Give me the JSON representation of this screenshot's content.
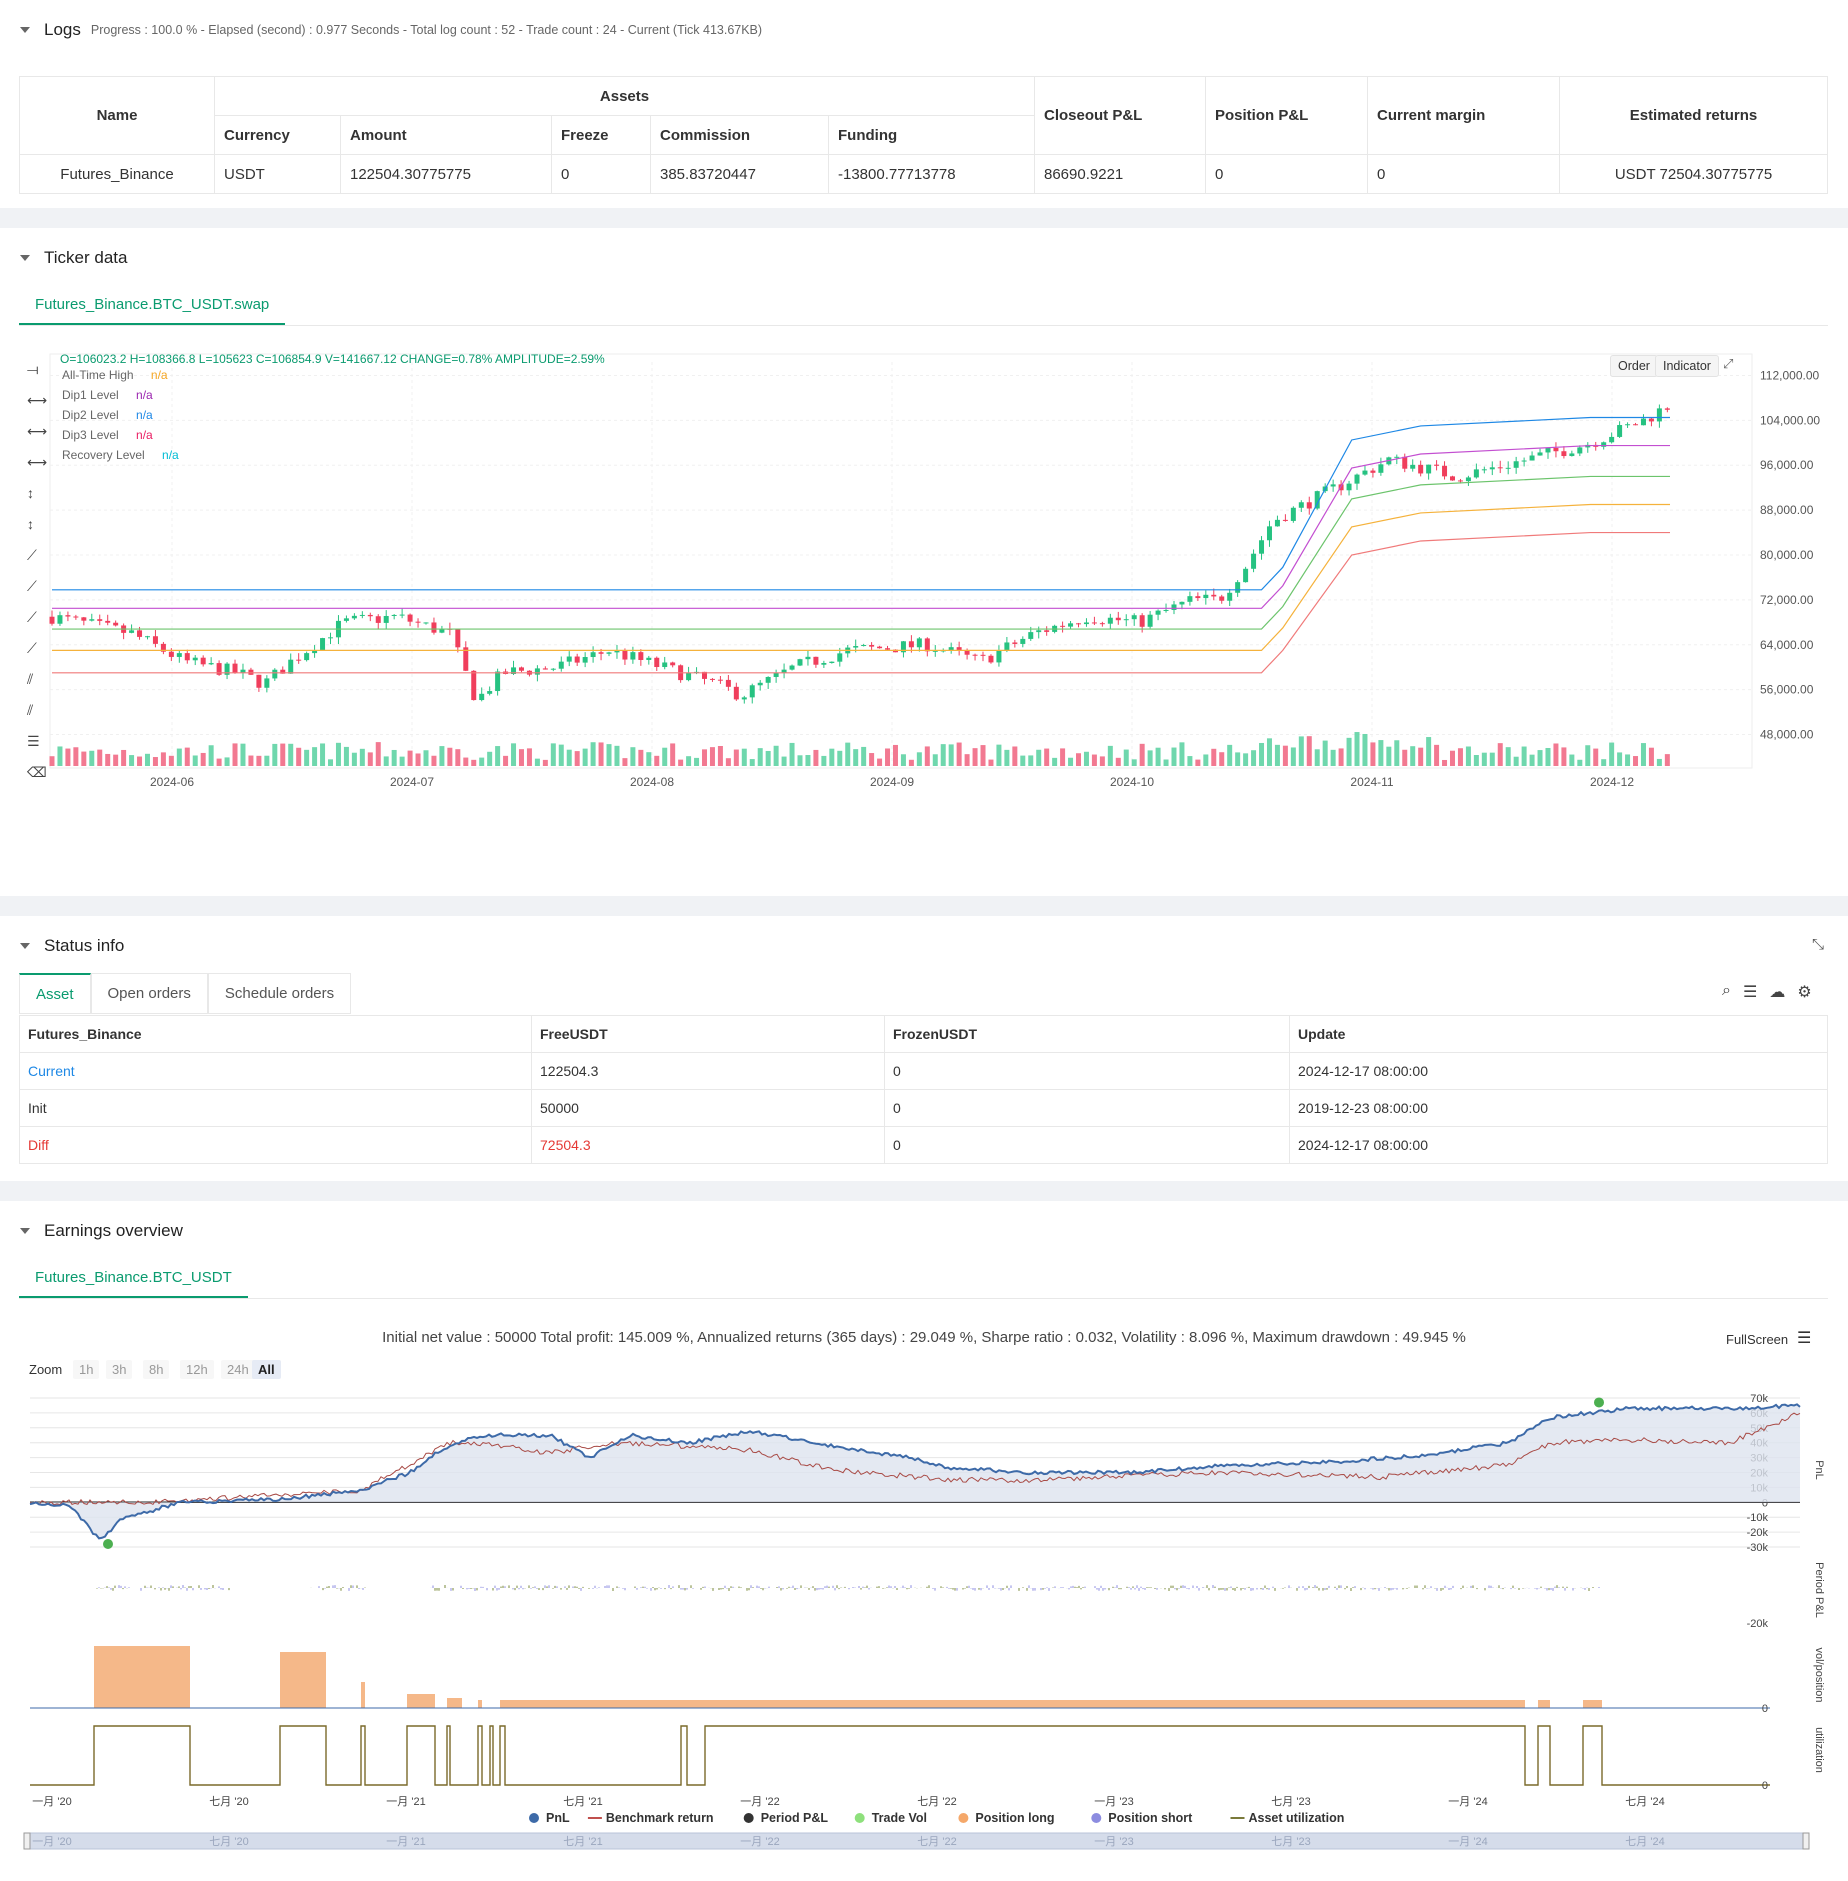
{
  "logs": {
    "title": "Logs",
    "info": "Progress : 100.0 % - Elapsed (second) : 0.977  Seconds - Total log count : 52 - Trade count : 24 - Current (Tick 413.67KB)"
  },
  "assets_table": {
    "h_name": "Name",
    "h_assets": "Assets",
    "h_closeout": "Closeout P&L",
    "h_position": "Position P&L",
    "h_margin": "Current margin",
    "h_est": "Estimated returns",
    "h_currency": "Currency",
    "h_amount": "Amount",
    "h_freeze": "Freeze",
    "h_commission": "Commission",
    "h_funding": "Funding",
    "row": {
      "name": "Futures_Binance",
      "currency": "USDT",
      "amount": "122504.30775775",
      "freeze": "0",
      "commission": "385.83720447",
      "funding": "-13800.77713778",
      "closeout": "86690.9221",
      "position": "0",
      "margin": "0",
      "est": "USDT 72504.30775775"
    }
  },
  "ticker": {
    "title": "Ticker data",
    "tab": "Futures_Binance.BTC_USDT.swap",
    "ohlc": "O=106023.2 H=108366.8 L=105623 C=106854.9 V=141667.12 CHANGE=0.78% AMPLITUDE=2.59%",
    "legend": [
      {
        "name": "All-Time High",
        "val": "n/a",
        "color": "#f5a623"
      },
      {
        "name": "Dip1 Level",
        "val": "n/a",
        "color": "#9c27b0"
      },
      {
        "name": "Dip2 Level",
        "val": "n/a",
        "color": "#1e88e5"
      },
      {
        "name": "Dip3 Level",
        "val": "n/a",
        "color": "#e91e63"
      },
      {
        "name": "Recovery Level",
        "val": "n/a",
        "color": "#00bcd4"
      }
    ],
    "order_btn": "Order",
    "indicator_btn": "Indicator",
    "y_ticks": [
      "112,000.00",
      "104,000.00",
      "96,000.00",
      "88,000.00",
      "80,000.00",
      "72,000.00",
      "64,000.00",
      "56,000.00",
      "48,000.00"
    ],
    "x_ticks": [
      "2024-06",
      "2024-07",
      "2024-08",
      "2024-09",
      "2024-10",
      "2024-11",
      "2024-12"
    ]
  },
  "status": {
    "title": "Status info",
    "tabs": [
      "Asset",
      "Open orders",
      "Schedule orders"
    ],
    "headers": [
      "Futures_Binance",
      "FreeUSDT",
      "FrozenUSDT",
      "Update"
    ],
    "rows": [
      [
        "Current",
        "122504.3",
        "0",
        "2024-12-17 08:00:00"
      ],
      [
        "Init",
        "50000",
        "0",
        "2019-12-23 08:00:00"
      ],
      [
        "Diff",
        "72504.3",
        "0",
        "2024-12-17 08:00:00"
      ]
    ],
    "colors": {
      "current": "#1e88e5",
      "diff": "#e53935"
    }
  },
  "earnings": {
    "title": "Earnings overview",
    "tab": "Futures_Binance.BTC_USDT",
    "summary": "Initial net value : 50000  Total profit: 145.009 %, Annualized returns (365 days) : 29.049 %, Sharpe ratio : 0.032, Volatility : 8.096 %, Maximum drawdown : 49.945 %",
    "fullscreen": "FullScreen",
    "zoom_label": "Zoom",
    "zoom_opts": [
      "1h",
      "3h",
      "8h",
      "12h",
      "24h",
      "All"
    ],
    "pnl_ticks": [
      "70k",
      "60k",
      "50k",
      "40k",
      "30k",
      "20k",
      "10k",
      "0",
      "-10k",
      "-20k",
      "-30k"
    ],
    "pp_tick": "-20k",
    "vol_tick": "0",
    "util_tick": "0",
    "axis_labels": [
      "PnL",
      "Period P&L",
      "vol/position",
      "utilization"
    ],
    "x_ticks": [
      "一月 '20",
      "七月 '20",
      "一月 '21",
      "七月 '21",
      "一月 '22",
      "七月 '22",
      "一月 '23",
      "七月 '23",
      "一月 '24",
      "七月 '24"
    ],
    "legend": [
      {
        "name": "PnL",
        "color": "#3d6aa8"
      },
      {
        "name": "Benchmark return",
        "color": "#c0504d"
      },
      {
        "name": "Period P&L",
        "color": "#333333"
      },
      {
        "name": "Trade Vol",
        "color": "#8ee07c"
      },
      {
        "name": "Position long",
        "color": "#f5a86a"
      },
      {
        "name": "Position short",
        "color": "#8c8ce0"
      },
      {
        "name": "Asset utilization",
        "color": "#7a7a3a"
      }
    ]
  },
  "chart_data": [
    {
      "type": "candlestick",
      "title": "Futures_Binance.BTC_USDT.swap",
      "ylim": [
        44000,
        116000
      ],
      "x_range": [
        "2024-05-01",
        "2024-12-17"
      ],
      "last_bar": {
        "open": 106023.2,
        "high": 108366.8,
        "low": 105623,
        "close": 106854.9,
        "volume": 141667.12
      },
      "levels": {
        "all_time_high": {
          "before_2024-11": 73800,
          "end": 104500
        },
        "dip1": {
          "before": 70500,
          "end": 99500
        },
        "dip2": {
          "before": 66800,
          "end": 94000
        },
        "dip3": {
          "before": 63000,
          "end": 89000
        },
        "recovery": {
          "before": 59000,
          "end": 84000
        }
      }
    },
    {
      "type": "line",
      "title": "PnL",
      "ylim": [
        -30000,
        70000
      ],
      "x_range": [
        "2020-01",
        "2024-12"
      ],
      "series": [
        {
          "name": "PnL",
          "start": 0,
          "min": -26000,
          "end": 68000
        },
        {
          "name": "Benchmark return",
          "start": 0,
          "end": 65000
        }
      ]
    }
  ]
}
